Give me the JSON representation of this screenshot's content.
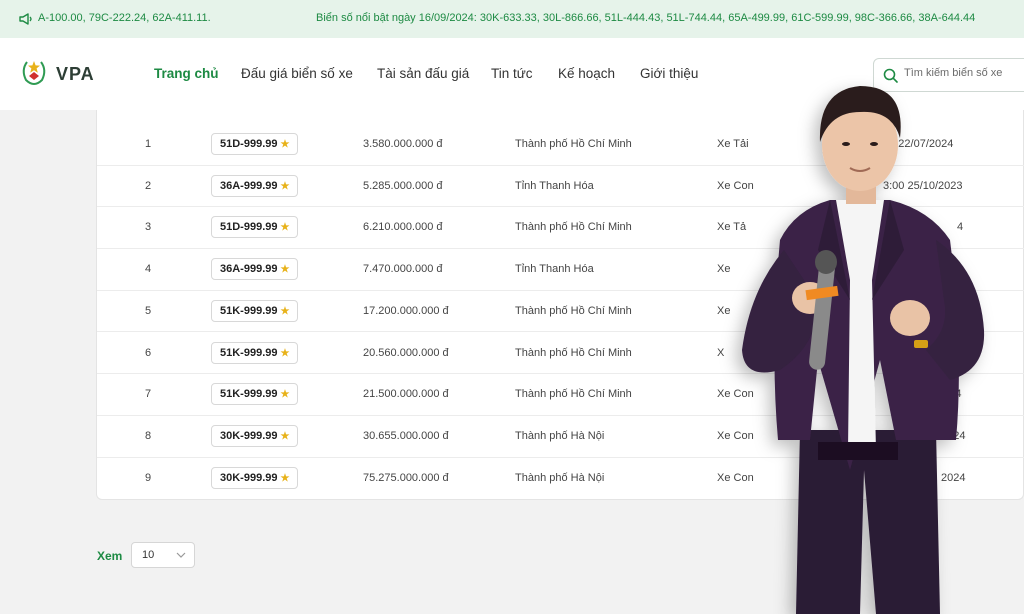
{
  "ticker": {
    "left_text": "A-100.00, 79C-222.24, 62A-411.11.",
    "right_text": "Biển số nổi bật ngày 16/09/2024: 30K-633.33, 30L-866.66, 51L-444.43, 51L-744.44, 65A-499.99, 61C-599.99, 98C-366.66, 38A-644.44"
  },
  "logo": {
    "text": "VPA"
  },
  "nav": [
    {
      "label": "Trang chủ",
      "active": true
    },
    {
      "label": "Đấu giá biển số xe",
      "active": false
    },
    {
      "label": "Tài sản đấu giá",
      "active": false
    },
    {
      "label": "Tin tức",
      "active": false
    },
    {
      "label": "Kế hoạch",
      "active": false
    },
    {
      "label": "Giới thiệu",
      "active": false
    }
  ],
  "search": {
    "placeholder": "Tìm kiếm biển số xe"
  },
  "table": {
    "rows": [
      {
        "index": "1",
        "plate": "51D-999.99",
        "price": "3.580.000.000 đ",
        "city": "Thành phố Hồ Chí Minh",
        "type": "Xe Tải",
        "date": "00 22/07/2024"
      },
      {
        "index": "2",
        "plate": "36A-999.99",
        "price": "5.285.000.000 đ",
        "city": "Tỉnh Thanh Hóa",
        "type": "Xe Con",
        "date": "3:00 25/10/2023"
      },
      {
        "index": "3",
        "plate": "51D-999.99",
        "price": "6.210.000.000 đ",
        "city": "Thành phố Hồ Chí Minh",
        "type": "Xe Tả",
        "date": "4"
      },
      {
        "index": "4",
        "plate": "36A-999.99",
        "price": "7.470.000.000 đ",
        "city": "Tỉnh Thanh Hóa",
        "type": "Xe",
        "date": ""
      },
      {
        "index": "5",
        "plate": "51K-999.99",
        "price": "17.200.000.000 đ",
        "city": "Thành phố Hồ Chí Minh",
        "type": "Xe",
        "date": ""
      },
      {
        "index": "6",
        "plate": "51K-999.99",
        "price": "20.560.000.000 đ",
        "city": "Thành phố Hồ Chí Minh",
        "type": "X",
        "date": ""
      },
      {
        "index": "7",
        "plate": "51K-999.99",
        "price": "21.500.000.000 đ",
        "city": "Thành phố Hồ Chí Minh",
        "type": "Xe Con",
        "date": "2024"
      },
      {
        "index": "8",
        "plate": "30K-999.99",
        "price": "30.655.000.000 đ",
        "city": "Thành phố Hà Nội",
        "type": "Xe Con",
        "date": "2024"
      },
      {
        "index": "9",
        "plate": "30K-999.99",
        "price": "75.275.000.000 đ",
        "city": "Thành phố Hà Nội",
        "type": "Xe Con",
        "date": "2024"
      }
    ]
  },
  "pager": {
    "label": "Xem",
    "page_size": "10"
  },
  "colors": {
    "brand_green": "#1d8a43",
    "star": "#e8b21a",
    "ticker_bg": "#e6f3ea"
  }
}
